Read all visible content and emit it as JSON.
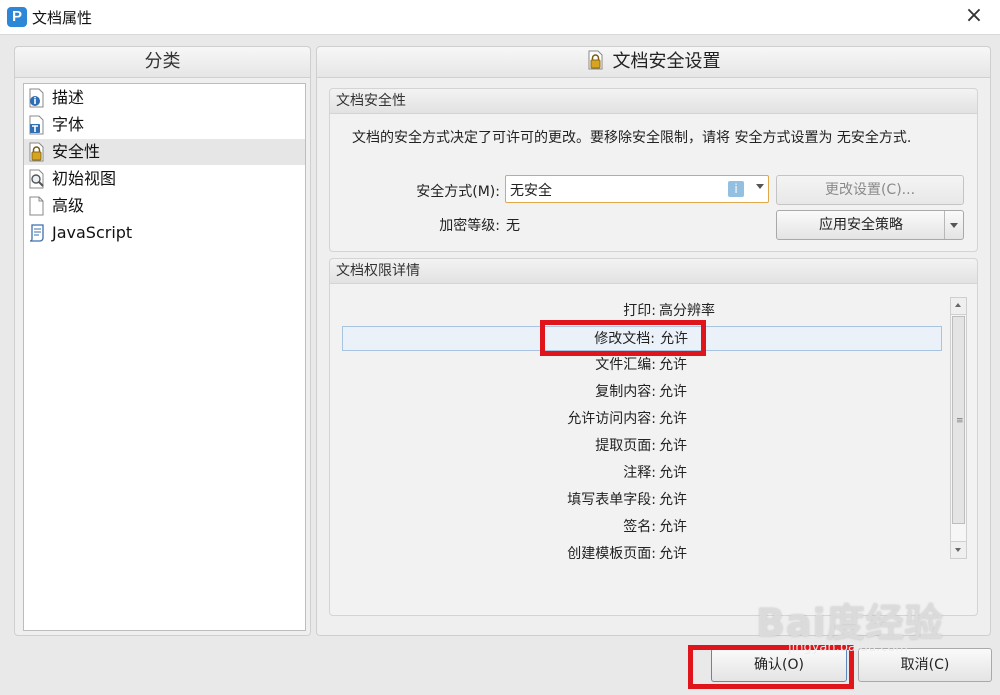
{
  "window": {
    "title": "文档属性",
    "logo_letter": "P",
    "close_glyph": "×"
  },
  "sidebar": {
    "header": "分类",
    "items": [
      {
        "label": "描述",
        "icon": "info-doc-icon",
        "selected": false
      },
      {
        "label": "字体",
        "icon": "font-doc-icon",
        "selected": false
      },
      {
        "label": "安全性",
        "icon": "lock-icon",
        "selected": true
      },
      {
        "label": "初始视图",
        "icon": "magnifier-doc-icon",
        "selected": false
      },
      {
        "label": "高级",
        "icon": "doc-icon",
        "selected": false
      },
      {
        "label": "JavaScript",
        "icon": "script-scroll-icon",
        "selected": false
      }
    ]
  },
  "main": {
    "title": "文档安全设置",
    "security_group": {
      "title": "文档安全性",
      "description": "文档的安全方式决定了可许可的更改。要移除安全限制，请将 安全方式设置为 无安全方式.",
      "method_label": "安全方式(M):",
      "method_value": "无安全",
      "info_badge": "i",
      "change_button": "更改设置(C)...",
      "policy_button": "应用安全策略",
      "encryption_label": "加密等级:",
      "encryption_value": "无"
    },
    "permissions_group": {
      "title": "文档权限详情",
      "rows": [
        {
          "key": "打印:",
          "value": "高分辨率"
        },
        {
          "key": "修改文档:",
          "value": "允许",
          "selected": true
        },
        {
          "key": "文件汇编:",
          "value": "允许"
        },
        {
          "key": "复制内容:",
          "value": "允许"
        },
        {
          "key": "允许访问内容:",
          "value": "允许"
        },
        {
          "key": "提取页面:",
          "value": "允许"
        },
        {
          "key": "注释:",
          "value": "允许"
        },
        {
          "key": "填写表单字段:",
          "value": "允许"
        },
        {
          "key": "签名:",
          "value": "允许"
        },
        {
          "key": "创建模板页面:",
          "value": "允许"
        }
      ]
    }
  },
  "footer": {
    "ok_button": "确认(O)",
    "cancel_button": "取消(C)"
  },
  "watermark": {
    "main": "Bai度经验",
    "sub": "jingyan.baidu.com"
  },
  "colors": {
    "highlight": "#e0151c",
    "logo": "#2e86d6",
    "select_border": "#e0a84a"
  }
}
